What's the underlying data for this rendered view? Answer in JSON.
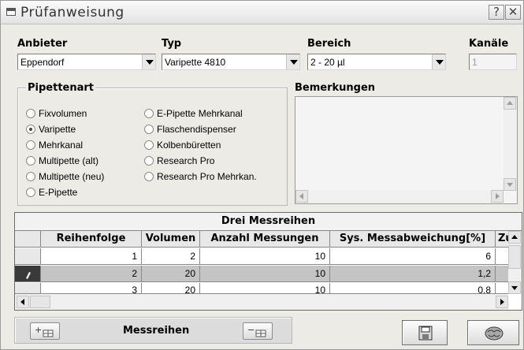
{
  "window": {
    "title": "Prüfanweisung",
    "help_button": "?",
    "close_button": "✕"
  },
  "fields": {
    "anbieter": {
      "label": "Anbieter",
      "value": "Eppendorf"
    },
    "typ": {
      "label": "Typ",
      "value": "Varipette 4810"
    },
    "bereich": {
      "label": "Bereich",
      "value": "2 - 20 µl"
    },
    "kanaele": {
      "label": "Kanäle",
      "value": "1"
    }
  },
  "pipettenart": {
    "label": "Pipettenart",
    "options": [
      {
        "label": "Fixvolumen",
        "selected": false
      },
      {
        "label": "Varipette",
        "selected": true
      },
      {
        "label": "Mehrkanal",
        "selected": false
      },
      {
        "label": "Multipette (alt)",
        "selected": false
      },
      {
        "label": "Multipette (neu)",
        "selected": false
      },
      {
        "label": "E-Pipette",
        "selected": false
      },
      {
        "label": "E-Pipette Mehrkanal",
        "selected": false
      },
      {
        "label": "Flaschendispenser",
        "selected": false
      },
      {
        "label": "Kolbenbüretten",
        "selected": false
      },
      {
        "label": "Research Pro",
        "selected": false
      },
      {
        "label": "Research Pro Mehrkan.",
        "selected": false
      }
    ]
  },
  "bemerkungen": {
    "label": "Bemerkungen",
    "value": ""
  },
  "grid": {
    "caption": "Drei Messreihen",
    "columns": [
      "Reihenfolge",
      "Volumen",
      "Anzahl Messungen",
      "Sys. Messabweichung[%]",
      "Zu"
    ],
    "rows": [
      [
        "1",
        "2",
        "10",
        "6"
      ],
      [
        "2",
        "20",
        "10",
        "1,2"
      ],
      [
        "3",
        "20",
        "10",
        "0,8"
      ]
    ],
    "selected_row": 1
  },
  "bottom": {
    "messreihen_label": "Messreihen",
    "add_button": "+",
    "remove_button": "−"
  }
}
